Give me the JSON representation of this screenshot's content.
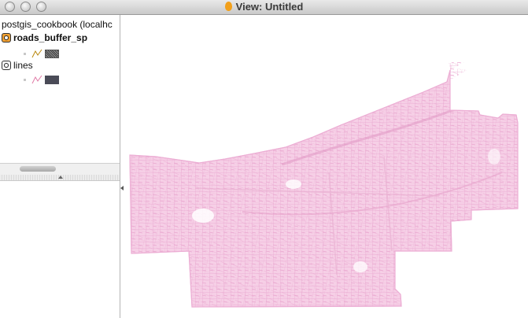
{
  "window": {
    "title": "View: Untitled"
  },
  "toc": {
    "connection": "postgis_cookbook (localhc",
    "layers": [
      {
        "name": "roads_buffer_sp",
        "bold": true,
        "active": true,
        "line_color": "#b8860b",
        "swatch": "hatched"
      },
      {
        "name": "lines",
        "bold": false,
        "active": false,
        "line_color": "#e07aa6",
        "swatch": "solid"
      }
    ]
  },
  "map": {
    "feature_color": "#f2b8dc",
    "stroke_color": "#ecaed4"
  }
}
